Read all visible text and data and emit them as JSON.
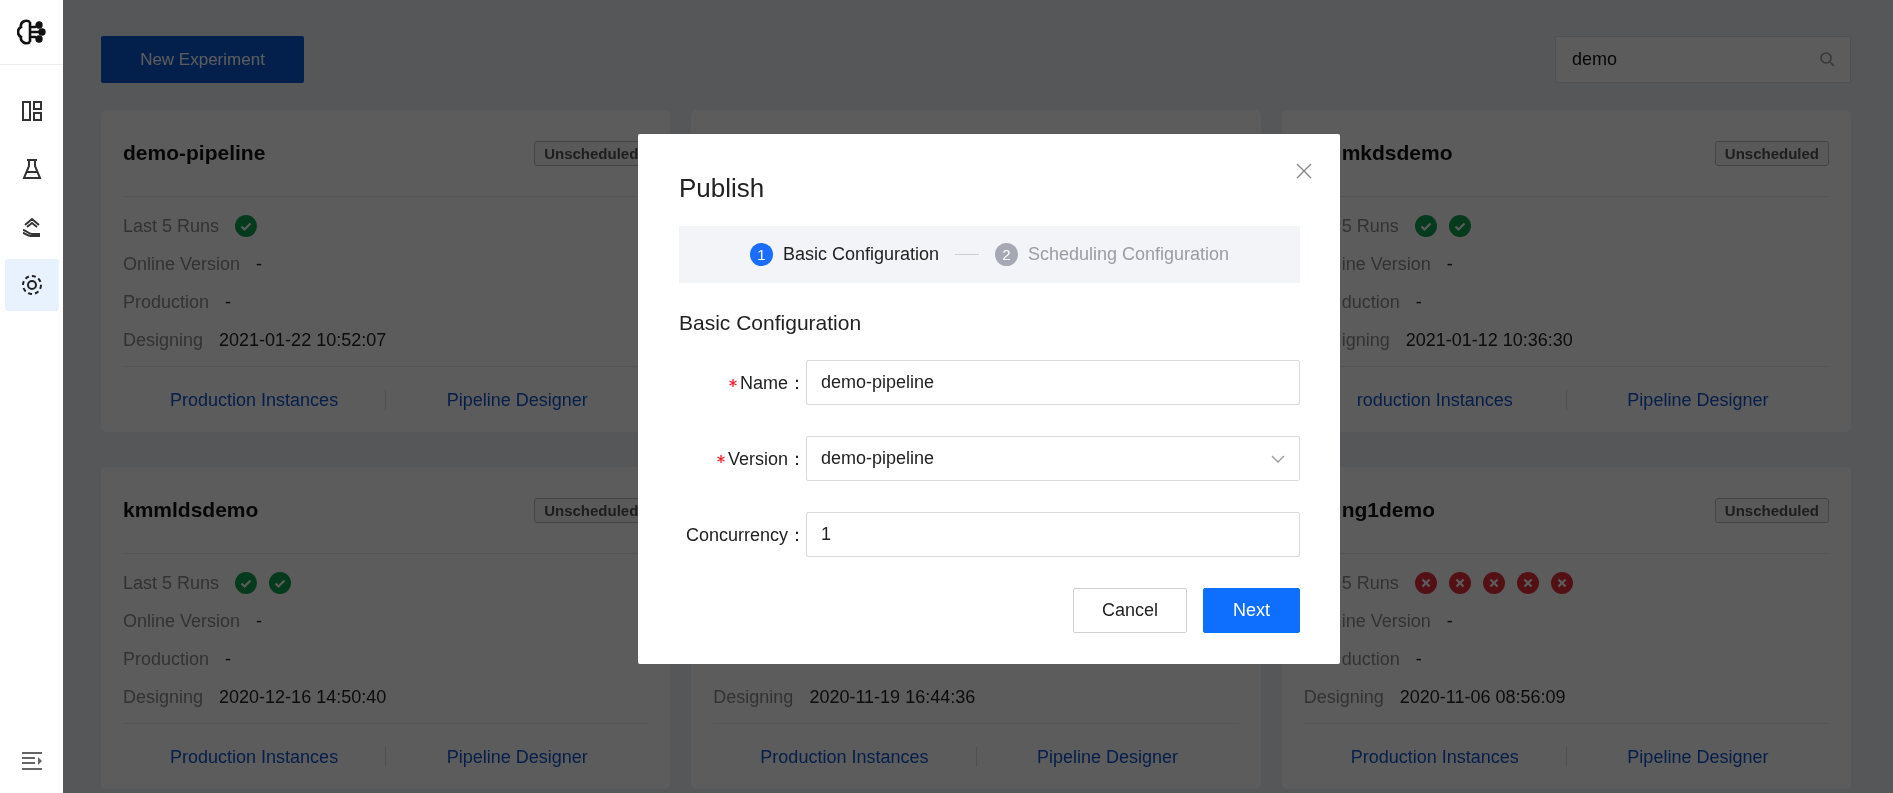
{
  "sidebar": {
    "items": [
      {
        "kind": "dashboard",
        "selected": false
      },
      {
        "kind": "flask",
        "selected": false
      },
      {
        "kind": "hand",
        "selected": false
      },
      {
        "kind": "target",
        "selected": true
      }
    ]
  },
  "toolbar": {
    "new_button": "New Experiment",
    "search": {
      "value": "demo"
    }
  },
  "card_rows": [
    {
      "left": {
        "title": "demo-pipeline",
        "badge": "Unscheduled",
        "runs_label": "Last 5 Runs",
        "runs": [
          {
            "kind": "success"
          }
        ],
        "online_label": "Online Version",
        "online_value": "-",
        "production_label": "Production",
        "production_value": "-",
        "designing_label": "Designing",
        "designing_value": "2021-01-22 10:52:07",
        "links": [
          "Production Instances",
          "Pipeline Designer"
        ]
      },
      "right": {
        "title": "mkdsdemo",
        "badge": "Unscheduled",
        "runs_label": "5 Runs",
        "runs": [
          {
            "kind": "success"
          },
          {
            "kind": "success"
          }
        ],
        "online_label": "ine Version",
        "online_value": "-",
        "production_label": "duction",
        "production_value": "-",
        "designing_label": "igning",
        "designing_value": "2021-01-12 10:36:30",
        "links": [
          "roduction Instances",
          "Pipeline Designer"
        ]
      }
    },
    {
      "left": {
        "title": "kmmldsdemo",
        "badge": "Unscheduled",
        "runs_label": "Last 5 Runs",
        "runs": [
          {
            "kind": "success"
          },
          {
            "kind": "success"
          }
        ],
        "online_label": "Online Version",
        "online_value": "-",
        "production_label": "Production",
        "production_value": "-",
        "designing_label": "Designing",
        "designing_value": "2020-12-16 14:50:40",
        "links": [
          "Production Instances",
          "Pipeline Designer"
        ]
      },
      "middle": {
        "designing_label": "Designing",
        "designing_value": "2020-11-19 16:44:36",
        "links": [
          "Production Instances",
          "Pipeline Designer"
        ]
      },
      "right": {
        "title": "ng1demo",
        "badge": "Unscheduled",
        "runs_label": "5 Runs",
        "runs": [
          {
            "kind": "failed"
          },
          {
            "kind": "failed"
          },
          {
            "kind": "failed"
          },
          {
            "kind": "failed"
          },
          {
            "kind": "failed"
          }
        ],
        "online_label": "ine Version",
        "online_value": "-",
        "production_label": "duction",
        "production_value": "-",
        "designing_label": "Designing",
        "designing_value": "2020-11-06 08:56:09",
        "links": [
          "Production Instances",
          "Pipeline Designer"
        ]
      }
    }
  ],
  "modal": {
    "title": "Publish",
    "steps": [
      {
        "number": "1",
        "label": "Basic Configuration",
        "selected": true
      },
      {
        "number": "2",
        "label": "Scheduling Configuration",
        "selected": false
      }
    ],
    "section_title": "Basic Configuration",
    "fields": [
      {
        "kind": "input",
        "label": "Name：",
        "required": true,
        "value": "demo-pipeline"
      },
      {
        "kind": "select",
        "label": "Version：",
        "required": true,
        "value": "demo-pipeline"
      },
      {
        "kind": "input",
        "label": "Concurrency：",
        "required": false,
        "value": "1"
      }
    ],
    "buttons": [
      {
        "kind": "default",
        "label": "Cancel"
      },
      {
        "kind": "primary",
        "label": "Next"
      }
    ]
  }
}
